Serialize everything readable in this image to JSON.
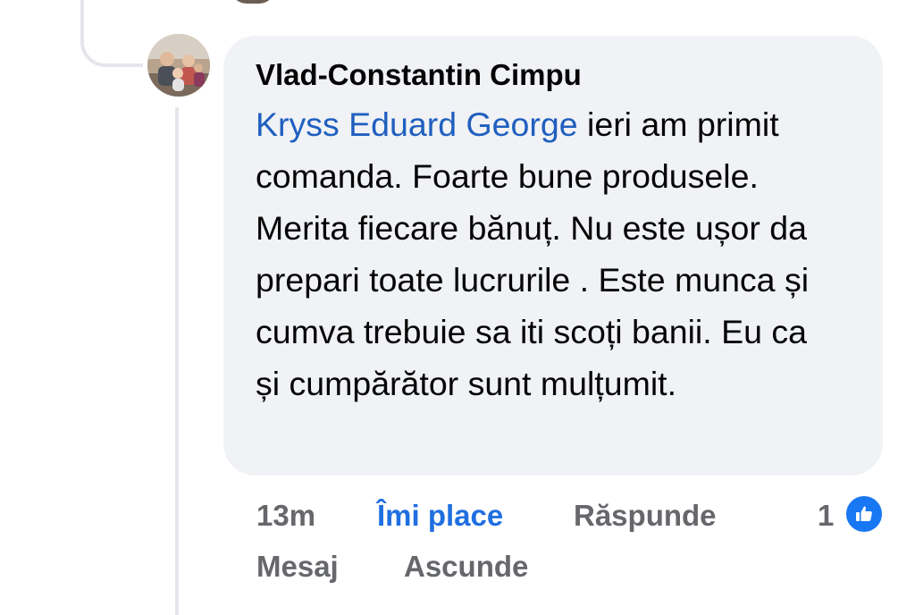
{
  "comment": {
    "author": "Vlad-Constantin Cimpu",
    "mention": "Kryss Eduard George",
    "text": " ieri am primit comanda. Foarte bune produsele. Merita fiecare bănuț. Nu este ușor da prepari toate lucrurile . Este munca și cumva trebuie sa iti scoți banii. Eu ca și cumpărător sunt mulțumit."
  },
  "actions": {
    "time": "13m",
    "like_label": "Îmi place",
    "reply_label": "Răspunde",
    "reaction_count": "1",
    "message_label": "Mesaj",
    "hide_label": "Ascunde"
  },
  "colors": {
    "bubble": "#f0f2f5",
    "mention": "#1f5fbf",
    "like_active": "#1f6fe0",
    "muted": "#65676b",
    "reaction_badge": "#1877f2"
  },
  "icons": {
    "reaction": "thumbs-up-icon"
  }
}
